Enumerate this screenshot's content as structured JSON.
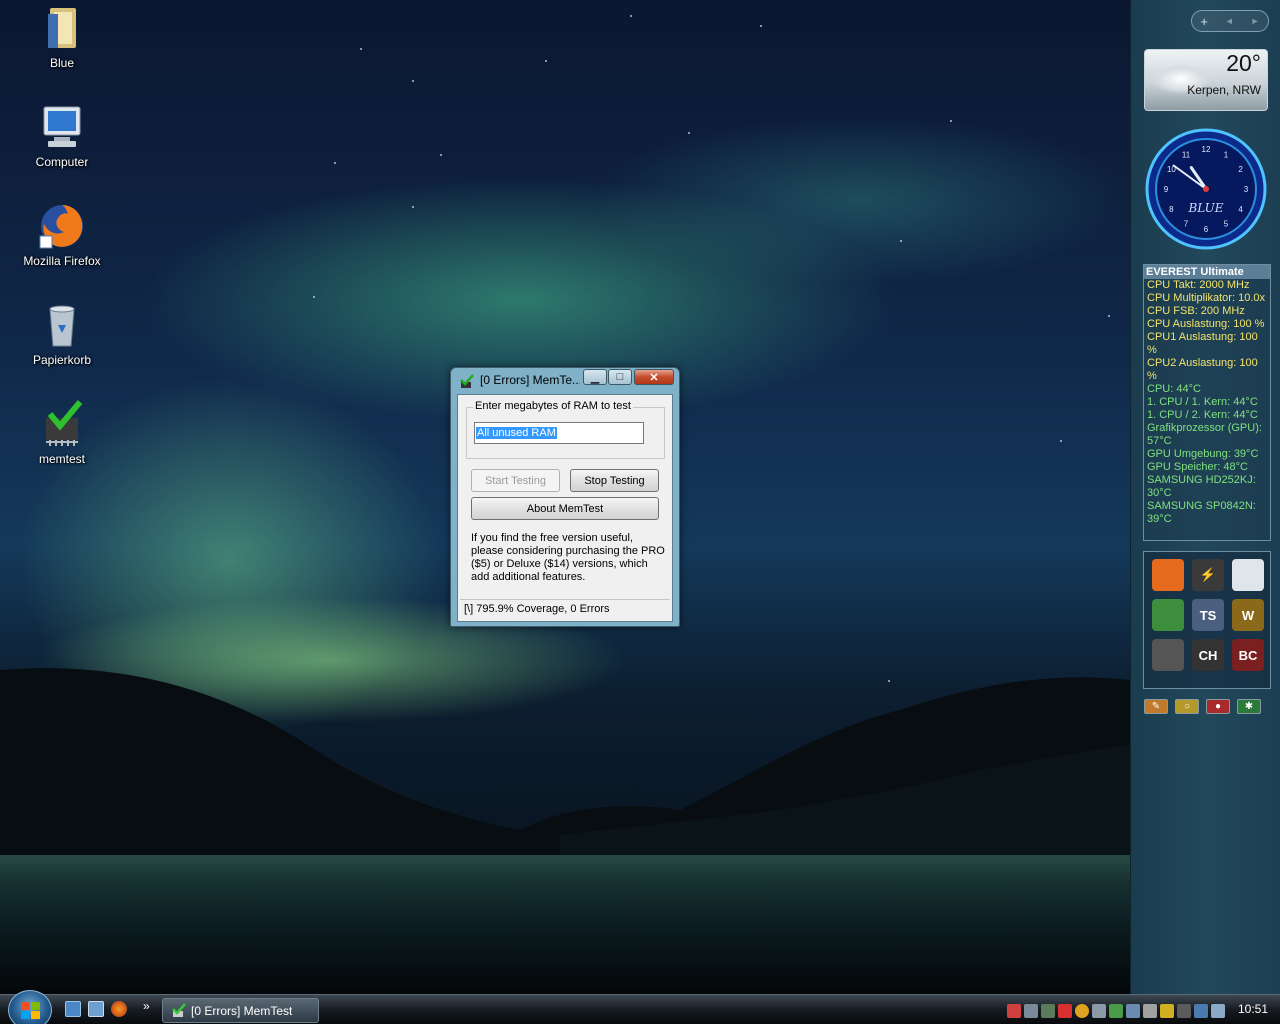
{
  "desktop": {
    "icons": [
      {
        "label": "Blue",
        "icon": "folder-icon"
      },
      {
        "label": "Computer",
        "icon": "computer-icon"
      },
      {
        "label": "Mozilla Firefox",
        "icon": "firefox-icon"
      },
      {
        "label": "Papierkorb",
        "icon": "recycle-bin-icon"
      },
      {
        "label": "memtest",
        "icon": "memtest-icon"
      }
    ]
  },
  "sidebar": {
    "controls": {
      "add": "+",
      "prev": "◄",
      "next": "►"
    },
    "weather": {
      "temperature": "20°",
      "location": "Kerpen, NRW"
    },
    "clock": {
      "brand": "BLUE",
      "time": "10:51"
    },
    "everest": {
      "title": "EVEREST Ultimate",
      "rows": [
        {
          "text": "CPU Takt: 2000 MHz",
          "color": "#f2e36b"
        },
        {
          "text": "CPU Multiplikator: 10.0x",
          "color": "#f2e36b"
        },
        {
          "text": "CPU FSB: 200 MHz",
          "color": "#f2e36b"
        },
        {
          "text": "CPU Auslastung: 100 %",
          "color": "#f2e36b"
        },
        {
          "text": "CPU1 Auslastung: 100 %",
          "color": "#f2e36b"
        },
        {
          "text": "CPU2 Auslastung: 100 %",
          "color": "#f2e36b"
        },
        {
          "text": "CPU: 44°C",
          "color": "#7fe07f"
        },
        {
          "text": "1. CPU / 1. Kern: 44°C",
          "color": "#7fe07f"
        },
        {
          "text": "1. CPU / 2. Kern: 44°C",
          "color": "#7fe07f"
        },
        {
          "text": "Grafikprozessor (GPU): 57°C",
          "color": "#7fe07f"
        },
        {
          "text": "GPU Umgebung: 39°C",
          "color": "#7fe07f"
        },
        {
          "text": "GPU Speicher: 48°C",
          "color": "#7fe07f"
        },
        {
          "text": "SAMSUNG HD252KJ: 30°C",
          "color": "#7fe07f"
        },
        {
          "text": "SAMSUNG SP0842N: 39°C",
          "color": "#7fe07f"
        }
      ]
    },
    "launcher": [
      {
        "icon": "firefox-icon",
        "glyph": "",
        "color": "#e66a1e"
      },
      {
        "icon": "winamp-icon",
        "glyph": "⚡",
        "color": "#3a3a3a"
      },
      {
        "icon": "racing-icon",
        "glyph": "",
        "color": "#dfe6ea"
      },
      {
        "icon": "messenger-icon",
        "glyph": "",
        "color": "#3c8d3c"
      },
      {
        "icon": "teamspeak-icon",
        "glyph": "TS",
        "color": "#4b5f80"
      },
      {
        "icon": "wow-icon",
        "glyph": "W",
        "color": "#8a6a1a"
      },
      {
        "icon": "steam-icon",
        "glyph": "",
        "color": "#555"
      },
      {
        "icon": "cheat-icon",
        "glyph": "CH",
        "color": "#333"
      },
      {
        "icon": "bc-icon",
        "glyph": "BC",
        "color": "#7a2020"
      }
    ],
    "tools": [
      {
        "icon": "wrench-icon",
        "glyph": "✎",
        "color": "#c07a2a"
      },
      {
        "icon": "lock-icon",
        "glyph": "○",
        "color": "#b49a2a"
      },
      {
        "icon": "power-icon",
        "glyph": "●",
        "color": "#a82a2a"
      },
      {
        "icon": "network-icon",
        "glyph": "✱",
        "color": "#2a7a3a"
      }
    ]
  },
  "memtest": {
    "title": "[0 Errors] MemTe...",
    "group_label": "Enter megabytes of RAM to test",
    "input_value": "All unused RAM",
    "start_label": "Start Testing",
    "stop_label": "Stop Testing",
    "about_label": "About MemTest",
    "promo_text": "If you find the free version useful, please considering purchasing the PRO ($5) or Deluxe ($14) versions, which add additional features.",
    "status": "[\\]   795.9% Coverage, 0 Errors",
    "caption": {
      "minimize": "▁",
      "maximize": "□",
      "close": "✕"
    }
  },
  "taskbar": {
    "quicklaunch_more": "»",
    "task_label": "[0 Errors] MemTest",
    "clock": "10:51"
  }
}
